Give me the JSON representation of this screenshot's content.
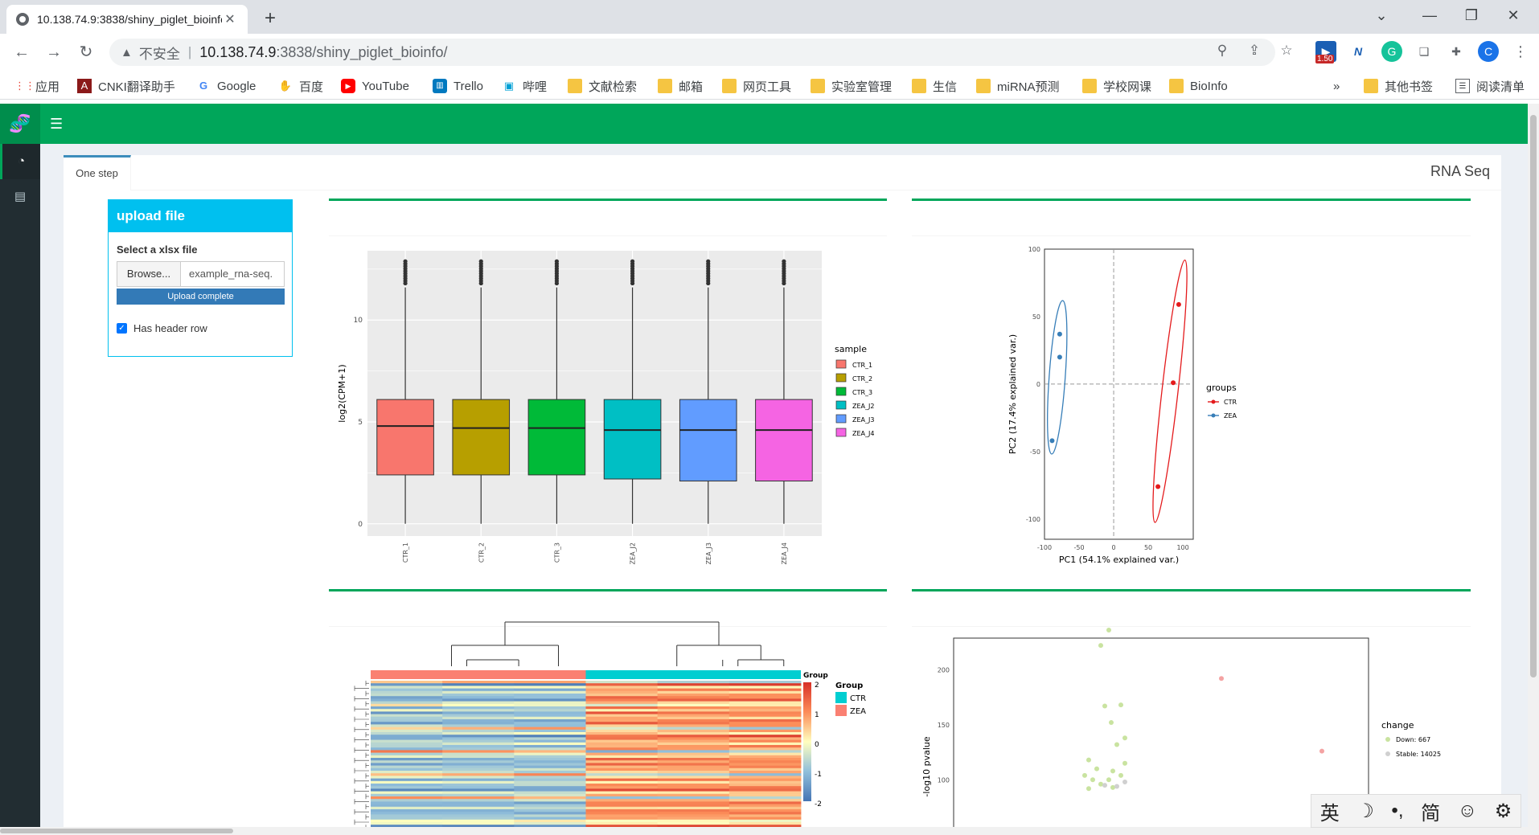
{
  "browser": {
    "tab_title": "10.138.74.9:3838/shiny_piglet_bioinfo/",
    "insecure_label": "不安全",
    "url_host": "10.138.74.9",
    "url_path": ":3838/shiny_piglet_bioinfo/",
    "ext_badge": "1.50",
    "profile_initial": "C"
  },
  "bookmarks": [
    {
      "label": "应用",
      "icon": "apps-grid-icon"
    },
    {
      "label": "CNKI翻译助手",
      "icon": "cnki-icon"
    },
    {
      "label": "Google",
      "icon": "google-icon"
    },
    {
      "label": "百度",
      "icon": "baidu-icon"
    },
    {
      "label": "YouTube",
      "icon": "youtube-icon"
    },
    {
      "label": "Trello",
      "icon": "trello-icon"
    },
    {
      "label": "哔哩",
      "icon": "bilibili-icon"
    },
    {
      "label": "文献检索",
      "icon": "folder-icon"
    },
    {
      "label": "邮箱",
      "icon": "folder-icon"
    },
    {
      "label": "网页工具",
      "icon": "folder-icon"
    },
    {
      "label": "实验室管理",
      "icon": "folder-icon"
    },
    {
      "label": "生信",
      "icon": "folder-icon"
    },
    {
      "label": "miRNA预测",
      "icon": "folder-icon"
    },
    {
      "label": "学校网课",
      "icon": "folder-icon"
    },
    {
      "label": "BioInfo",
      "icon": "folder-icon"
    }
  ],
  "bookmarks_overflow": "»",
  "other_bookmarks": "其他书签",
  "reading_list": "阅读清单",
  "app": {
    "tab_label": "One step",
    "page_title": "RNA Seq",
    "upload": {
      "title": "upload file",
      "field_label": "Select a xlsx file",
      "browse_label": "Browse...",
      "filename": "example_rna-seq.",
      "progress_label": "Upload complete",
      "header_checkbox_label": "Has header row",
      "header_checked": true
    }
  },
  "chart_data": [
    {
      "type": "box",
      "ylabel": "log2(CPM+1)",
      "yticks": [
        "0",
        "5",
        "10"
      ],
      "ylim": [
        -0.6,
        13.4
      ],
      "legend_title": "sample",
      "categories": [
        "CTR_1",
        "CTR_2",
        "CTR_3",
        "ZEA_J2",
        "ZEA_J3",
        "ZEA_J4"
      ],
      "colors": [
        "#f8766d",
        "#b79f00",
        "#00ba38",
        "#00bfc4",
        "#619cff",
        "#f564e3"
      ],
      "boxes": [
        {
          "whisker_low": 0,
          "q1": 2.4,
          "median": 4.8,
          "q3": 6.1,
          "whisker_high": 11.6
        },
        {
          "whisker_low": 0,
          "q1": 2.4,
          "median": 4.7,
          "q3": 6.1,
          "whisker_high": 11.6
        },
        {
          "whisker_low": 0,
          "q1": 2.4,
          "median": 4.7,
          "q3": 6.1,
          "whisker_high": 11.6
        },
        {
          "whisker_low": 0,
          "q1": 2.2,
          "median": 4.6,
          "q3": 6.1,
          "whisker_high": 11.6
        },
        {
          "whisker_low": 0,
          "q1": 2.1,
          "median": 4.6,
          "q3": 6.1,
          "whisker_high": 11.6
        },
        {
          "whisker_low": 0,
          "q1": 2.1,
          "median": 4.6,
          "q3": 6.1,
          "whisker_high": 11.6
        }
      ],
      "outlier_range": [
        11.8,
        12.9
      ]
    },
    {
      "type": "scatter",
      "xlabel": "PC1 (54.1% explained var.)",
      "ylabel": "PC2 (17.4% explained var.)",
      "xlim": [
        -100,
        115
      ],
      "ylim": [
        -115,
        100
      ],
      "xticks": [
        -100,
        -50,
        0,
        50,
        100
      ],
      "yticks": [
        -100,
        -50,
        0,
        50,
        100
      ],
      "legend_title": "groups",
      "series": [
        {
          "name": "CTR",
          "color": "#e41a1c",
          "points": [
            [
              64,
              -76
            ],
            [
              86,
              1
            ],
            [
              94,
              59
            ]
          ]
        },
        {
          "name": "ZEA",
          "color": "#377eb8",
          "points": [
            [
              -89,
              -42
            ],
            [
              -78,
              20
            ],
            [
              -78,
              37
            ]
          ]
        }
      ]
    },
    {
      "type": "heatmap",
      "annotation_title": "Group",
      "legend_title": "Group",
      "groups": [
        {
          "name": "CTR",
          "color": "#00ced1"
        },
        {
          "name": "ZEA",
          "color": "#fa8072"
        }
      ],
      "color_scale_ticks": [
        "2",
        "1",
        "0",
        "-1",
        "-2"
      ],
      "columns": 6
    },
    {
      "type": "scatter",
      "ylabel": "-log10 pvalue",
      "yticks": [
        100,
        150,
        200
      ],
      "legend_title": "change",
      "legend_entries": [
        "Down: 667",
        "Stable: 14025"
      ],
      "colors": {
        "down": "#c9e3a0",
        "stable": "#d0d0d0",
        "up": "#f4a3a3"
      }
    }
  ],
  "ime": {
    "lang": "英",
    "moon": "☽",
    "punct": "•,",
    "mode": "简",
    "emoji": "☺",
    "gear": "⚙"
  }
}
